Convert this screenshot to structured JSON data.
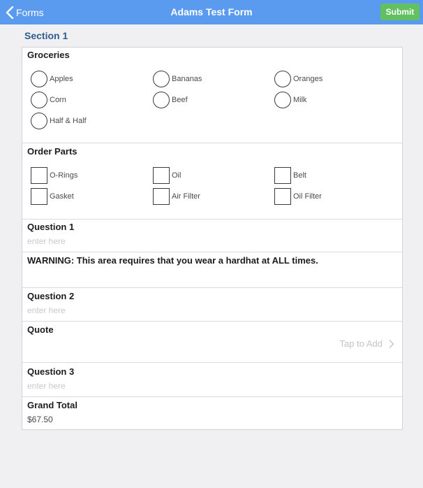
{
  "navbar": {
    "back_label": "Forms",
    "title": "Adams Test Form",
    "submit_label": "Submit"
  },
  "section": {
    "title": "Section 1"
  },
  "groceries": {
    "label": "Groceries",
    "options": [
      "Apples",
      "Bananas",
      "Oranges",
      "Corn",
      "Beef",
      "Milk",
      "Half & Half"
    ]
  },
  "order_parts": {
    "label": "Order Parts",
    "options": [
      "O-Rings",
      "Oil",
      "Belt",
      "Gasket",
      "Air Filter",
      "Oil Filter"
    ]
  },
  "question1": {
    "label": "Question 1",
    "placeholder": "enter here",
    "value": ""
  },
  "warning": {
    "text": "WARNING: This area requires that you wear a hardhat at ALL times."
  },
  "question2": {
    "label": "Question 2",
    "placeholder": "enter here",
    "value": ""
  },
  "quote": {
    "label": "Quote",
    "action_label": "Tap to Add"
  },
  "question3": {
    "label": "Question 3",
    "placeholder": "enter here",
    "value": ""
  },
  "grand_total": {
    "label": "Grand Total",
    "value": "$67.50"
  },
  "colors": {
    "navbar": "#5b9bef",
    "submit": "#62c061",
    "section_title": "#2e5c8e",
    "background": "#f0f0f2"
  }
}
